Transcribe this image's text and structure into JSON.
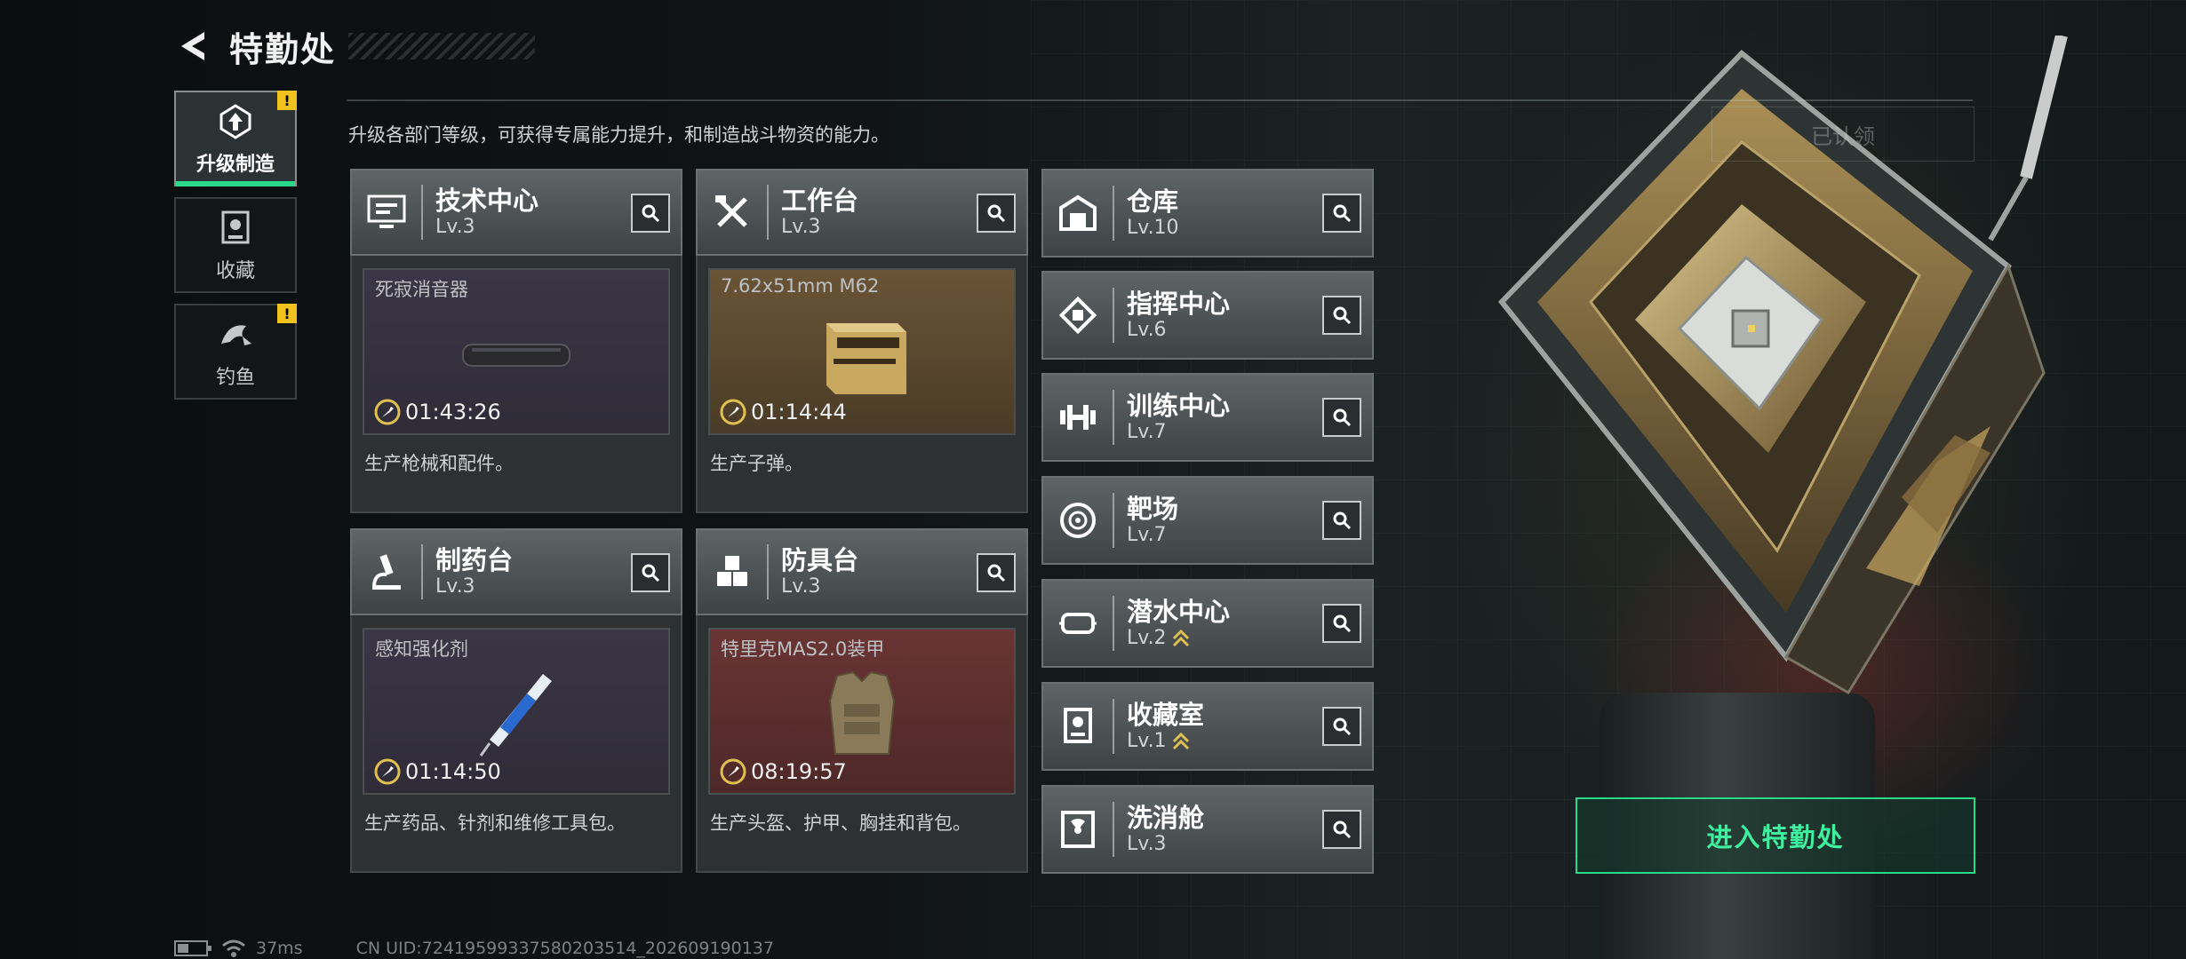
{
  "header": {
    "title": "特勤处"
  },
  "side_nav": [
    {
      "label": "升级制造",
      "icon": "upgrade-icon",
      "active": true,
      "alert": true
    },
    {
      "label": "收藏",
      "icon": "collection-icon",
      "active": false,
      "alert": false
    },
    {
      "label": "钓鱼",
      "icon": "fish-icon",
      "active": false,
      "alert": true
    }
  ],
  "alert_symbol": "!",
  "description": "升级各部门等级，可获得专属能力提升，和制造战斗物资的能力。",
  "departments": [
    {
      "name": "技术中心",
      "level": "Lv.3",
      "icon": "monitor-icon",
      "product": "死寂消音器",
      "timer": "01:43:26",
      "desc": "生产枪械和配件。",
      "theme": "purple"
    },
    {
      "name": "工作台",
      "level": "Lv.3",
      "icon": "tools-icon",
      "product": "7.62x51mm M62",
      "timer": "01:14:44",
      "desc": "生产子弹。",
      "theme": "gold"
    },
    {
      "name": "制药台",
      "level": "Lv.3",
      "icon": "microscope-icon",
      "product": "感知强化剂",
      "timer": "01:14:50",
      "desc": "生产药品、针剂和维修工具包。",
      "theme": "purple"
    },
    {
      "name": "防具台",
      "level": "Lv.3",
      "icon": "cubes-icon",
      "product": "特里克MAS2.0装甲",
      "timer": "08:19:57",
      "desc": "生产头盔、护甲、胸挂和背包。",
      "theme": "red"
    }
  ],
  "facilities": [
    {
      "name": "仓库",
      "level": "Lv.10",
      "icon": "warehouse-icon",
      "upgradable": false
    },
    {
      "name": "指挥中心",
      "level": "Lv.6",
      "icon": "chip-icon",
      "upgradable": false
    },
    {
      "name": "训练中心",
      "level": "Lv.7",
      "icon": "dumbbell-icon",
      "upgradable": false
    },
    {
      "name": "靶场",
      "level": "Lv.7",
      "icon": "target-icon",
      "upgradable": false
    },
    {
      "name": "潜水中心",
      "level": "Lv.2",
      "icon": "goggles-icon",
      "upgradable": true
    },
    {
      "name": "收藏室",
      "level": "Lv.1",
      "icon": "trophy-icon",
      "upgradable": true
    },
    {
      "name": "洗消舱",
      "level": "Lv.3",
      "icon": "radiation-icon",
      "upgradable": false
    }
  ],
  "ghost_button": "已认领",
  "enter_button": "进入特勤处",
  "footer": {
    "ping": "37ms",
    "uid": "CN UID:724195993375802035​14_202609190137"
  },
  "colors": {
    "accent": "#2ad98c",
    "alert": "#f2c21e",
    "gold": "#e0c050"
  }
}
